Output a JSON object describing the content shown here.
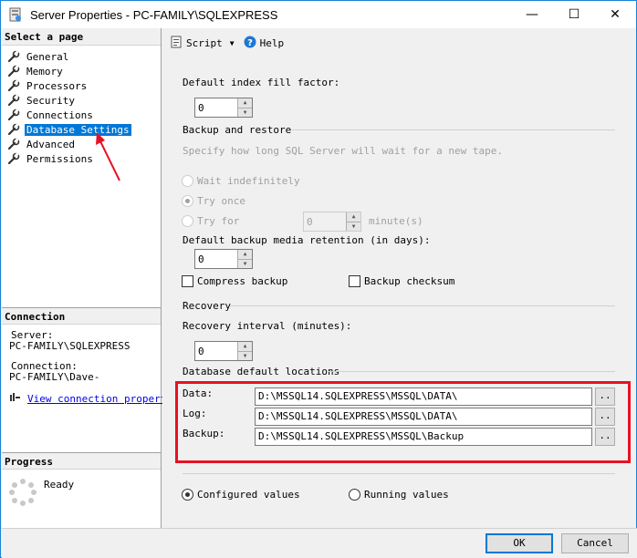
{
  "window": {
    "title": "Server Properties - PC-FAMILY\\SQLEXPRESS",
    "minimize_glyph": "—",
    "maximize_glyph": "☐",
    "close_glyph": "✕"
  },
  "left_panel": {
    "select_page_header": "Select a page",
    "pages": [
      {
        "label": "General",
        "icon": "wrench-icon"
      },
      {
        "label": "Memory",
        "icon": "wrench-icon"
      },
      {
        "label": "Processors",
        "icon": "wrench-icon"
      },
      {
        "label": "Security",
        "icon": "wrench-icon"
      },
      {
        "label": "Connections",
        "icon": "wrench-icon"
      },
      {
        "label": "Database Settings",
        "icon": "wrench-icon",
        "selected": true
      },
      {
        "label": "Advanced",
        "icon": "wrench-icon"
      },
      {
        "label": "Permissions",
        "icon": "wrench-icon"
      }
    ],
    "connection": {
      "header": "Connection",
      "server_label": "Server:",
      "server_value": "PC-FAMILY\\SQLEXPRESS",
      "connection_label": "Connection:",
      "connection_value": "PC-FAMILY\\Dave-",
      "view_link": "View connection properti"
    },
    "progress": {
      "header": "Progress",
      "status": "Ready"
    }
  },
  "toolbar": {
    "script_label": "Script",
    "help_label": "Help"
  },
  "content": {
    "fill_factor_label": "Default index fill factor:",
    "fill_factor_value": "0",
    "backup_restore_title": "Backup and restore",
    "backup_restore_desc": "Specify how long SQL Server will wait for a new tape.",
    "wait_indefinitely": "Wait indefinitely",
    "try_once": "Try once",
    "try_for": "Try for",
    "try_for_value": "0",
    "minutes_label": "minute(s)",
    "retention_label": "Default backup media retention (in days):",
    "retention_value": "0",
    "compress_backup": "Compress backup",
    "backup_checksum": "Backup checksum",
    "recovery_title": "Recovery",
    "recovery_interval_label": "Recovery interval (minutes):",
    "recovery_interval_value": "0",
    "locations_title": "Database default locations",
    "data_label": "Data:",
    "data_path": "D:\\MSSQL14.SQLEXPRESS\\MSSQL\\DATA\\",
    "log_label": "Log:",
    "log_path": "D:\\MSSQL14.SQLEXPRESS\\MSSQL\\DATA\\",
    "backup_label": "Backup:",
    "backup_path": "D:\\MSSQL14.SQLEXPRESS\\MSSQL\\Backup",
    "browse_label": "..",
    "configured_values": "Configured values",
    "running_values": "Running values"
  },
  "buttons": {
    "ok": "OK",
    "cancel": "Cancel"
  },
  "colors": {
    "selection": "#0078d7",
    "annotation_red": "#e81123",
    "link": "#0000ee"
  }
}
